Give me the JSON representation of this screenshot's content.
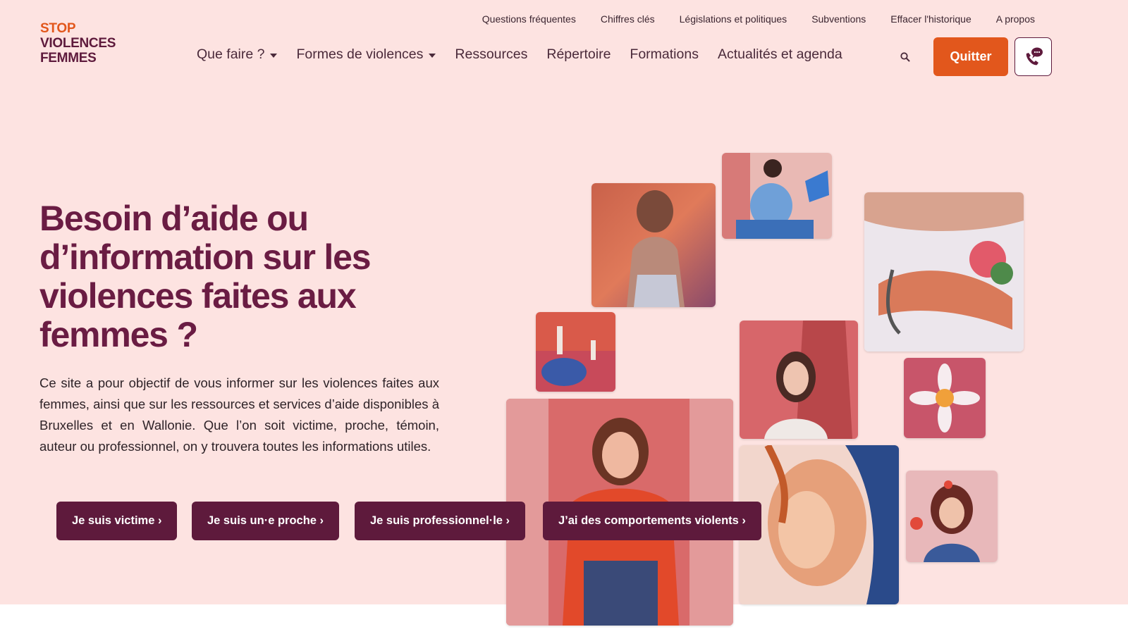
{
  "brand": {
    "logo_line1": "STOP",
    "logo_line2": "VIOLENCES",
    "logo_line3": "FEMMES",
    "accent_orange": "#e2571c",
    "accent_plum": "#5e1a3c",
    "background_pink": "#fde3e1"
  },
  "top_nav": {
    "items": [
      "Questions fréquentes",
      "Chiffres clés",
      "Législations et politiques",
      "Subventions",
      "Effacer l'historique",
      "A propos"
    ]
  },
  "main_nav": {
    "items": [
      {
        "label": "Que faire ?",
        "has_dropdown": true
      },
      {
        "label": "Formes de violences",
        "has_dropdown": true
      },
      {
        "label": "Ressources",
        "has_dropdown": false
      },
      {
        "label": "Répertoire",
        "has_dropdown": false
      },
      {
        "label": "Formations",
        "has_dropdown": false
      },
      {
        "label": "Actualités et agenda",
        "has_dropdown": false
      }
    ],
    "search_icon": "search-icon",
    "quit_label": "Quitter",
    "help_icon": "phone-chat-icon"
  },
  "hero": {
    "headline": "Besoin d’aide ou d’information sur les violences faites aux femmes ?",
    "intro": "Ce site a pour objectif de vous informer sur les violences faites aux femmes, ainsi que sur les ressources et services d’aide disponibles à Bruxelles et en Wallonie. Que l’on soit victime, proche, témoin, auteur ou professionnel, on y trouvera toutes les informations utiles.",
    "cta_buttons": [
      {
        "label": "Je suis victime ›"
      },
      {
        "label": "Je suis un·e proche ›"
      },
      {
        "label": "Je suis professionnel·le ›"
      },
      {
        "label": "J’ai des comportements violents ›"
      }
    ]
  }
}
